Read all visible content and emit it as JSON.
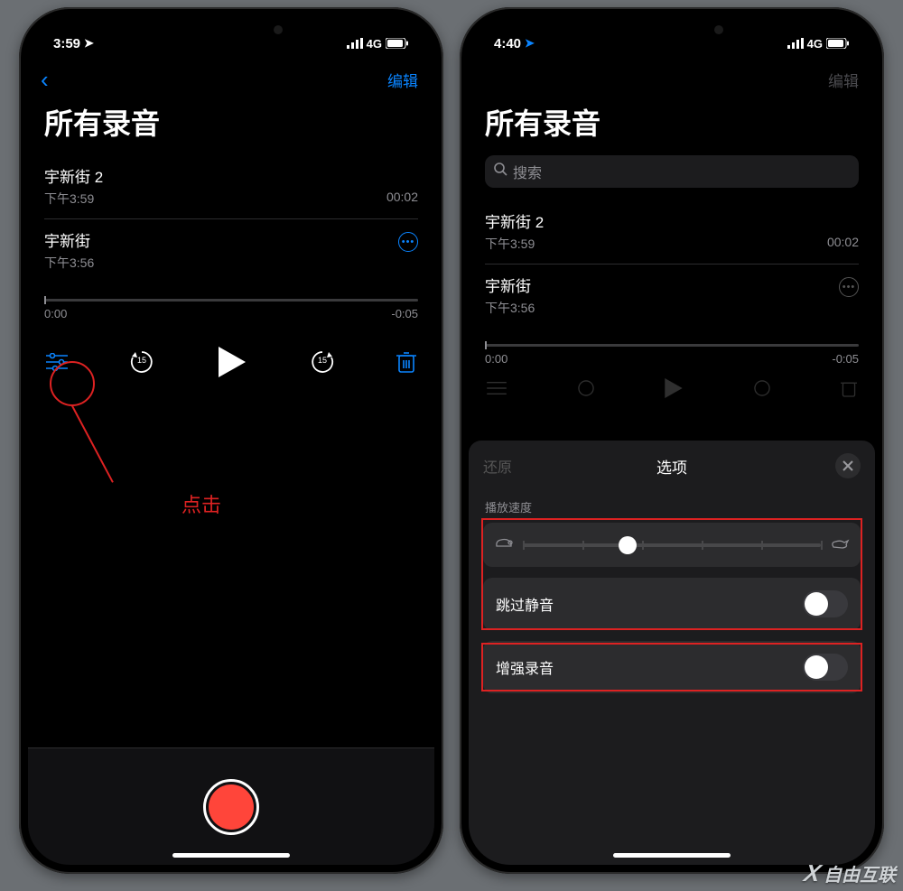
{
  "left": {
    "status": {
      "time": "3:59",
      "network": "4G"
    },
    "nav": {
      "edit": "编辑"
    },
    "title": "所有录音",
    "items": [
      {
        "name": "宇新街 2",
        "subtitle": "下午3:59",
        "duration": "00:02"
      },
      {
        "name": "宇新街",
        "subtitle": "下午3:56",
        "duration": ""
      }
    ],
    "player": {
      "elapsed": "0:00",
      "remaining": "-0:05",
      "skip": "15"
    },
    "annotation": "点击"
  },
  "right": {
    "status": {
      "time": "4:40",
      "network": "4G"
    },
    "nav": {
      "edit": "编辑"
    },
    "title": "所有录音",
    "search_placeholder": "搜索",
    "items": [
      {
        "name": "宇新街 2",
        "subtitle": "下午3:59",
        "duration": "00:02"
      },
      {
        "name": "宇新街",
        "subtitle": "下午3:56",
        "duration": ""
      }
    ],
    "player": {
      "elapsed": "0:00",
      "remaining": "-0:05"
    },
    "sheet": {
      "reset": "还原",
      "title": "选项",
      "speed_label": "播放速度",
      "skip_silence": "跳过静音",
      "enhance": "增强录音"
    }
  },
  "watermark": "自由互联"
}
